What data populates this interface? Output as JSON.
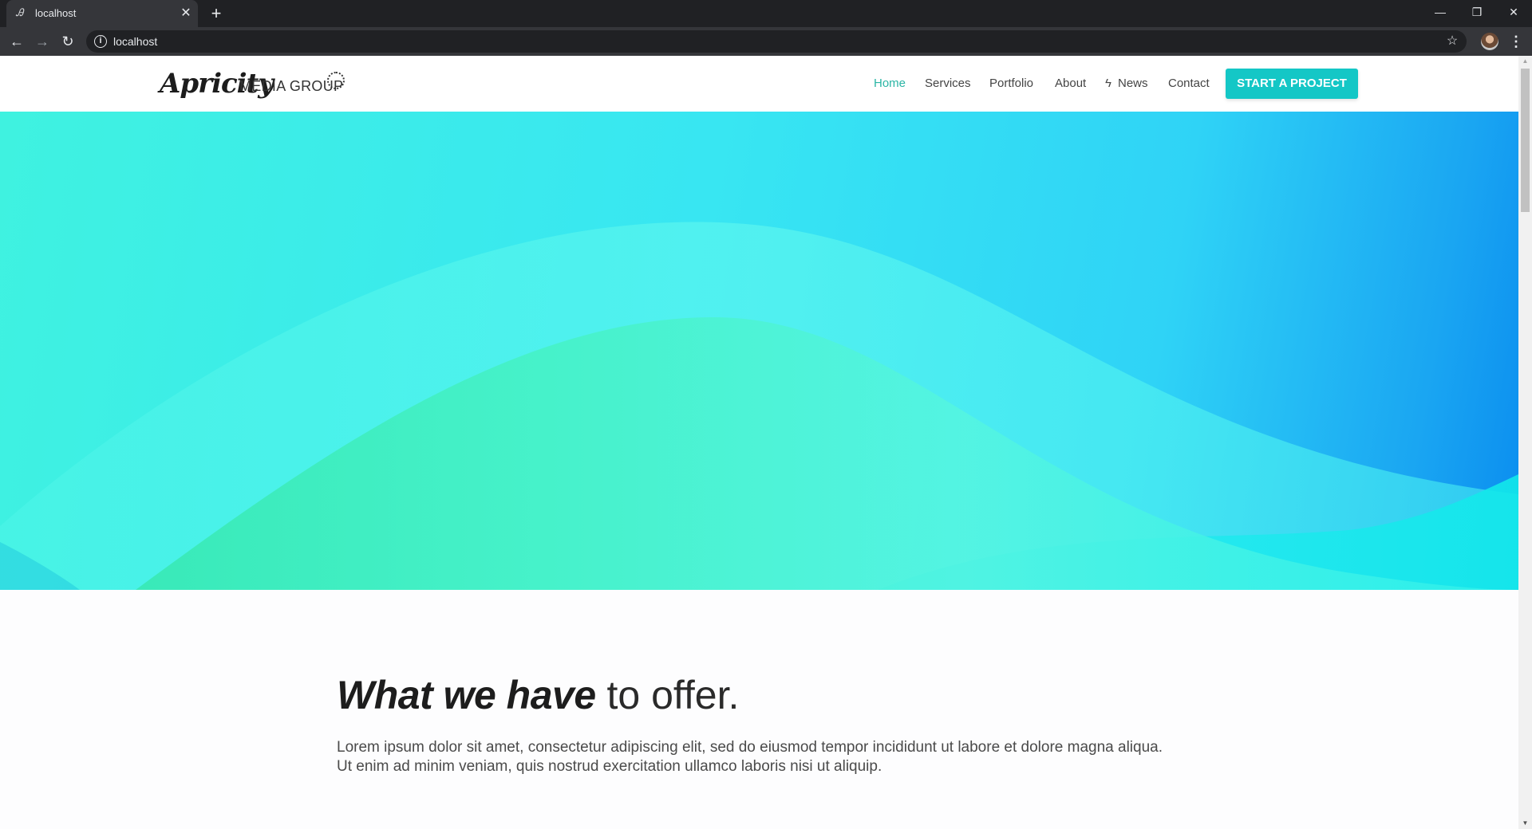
{
  "browser": {
    "tab_title": "localhost",
    "tab_favicon": "Ꭿ",
    "tab_close": "✕",
    "new_tab": "+",
    "window_controls": {
      "minimize": "—",
      "restore": "❐",
      "close": "✕"
    },
    "nav": {
      "back": "←",
      "forward": "→",
      "reload": "↻"
    },
    "address": "localhost",
    "info_icon": "i",
    "bookmark_icon": "☆",
    "menu_icon": "⋮"
  },
  "site": {
    "logo": {
      "script": "Apricity",
      "text": "MEDIA GROUP"
    },
    "nav": {
      "home": "Home",
      "services": "Services",
      "portfolio": "Portfolio",
      "about": "About",
      "news": "News",
      "news_icon": "ϟ",
      "contact": "Contact"
    },
    "cta": "START A PROJECT",
    "colors": {
      "accent": "#14c7c6",
      "active_nav": "#2bb5a5"
    }
  },
  "content": {
    "headline_bold": "What we have",
    "headline_light": " to offer.",
    "body": "Lorem ipsum dolor sit amet, consectetur adipiscing elit, sed do eiusmod tempor incididunt ut labore et dolore magna aliqua. Ut enim ad minim veniam, quis nostrud exercitation ullamco laboris nisi ut aliquip."
  },
  "scrollbar": {
    "up": "▲",
    "down": "▼"
  }
}
